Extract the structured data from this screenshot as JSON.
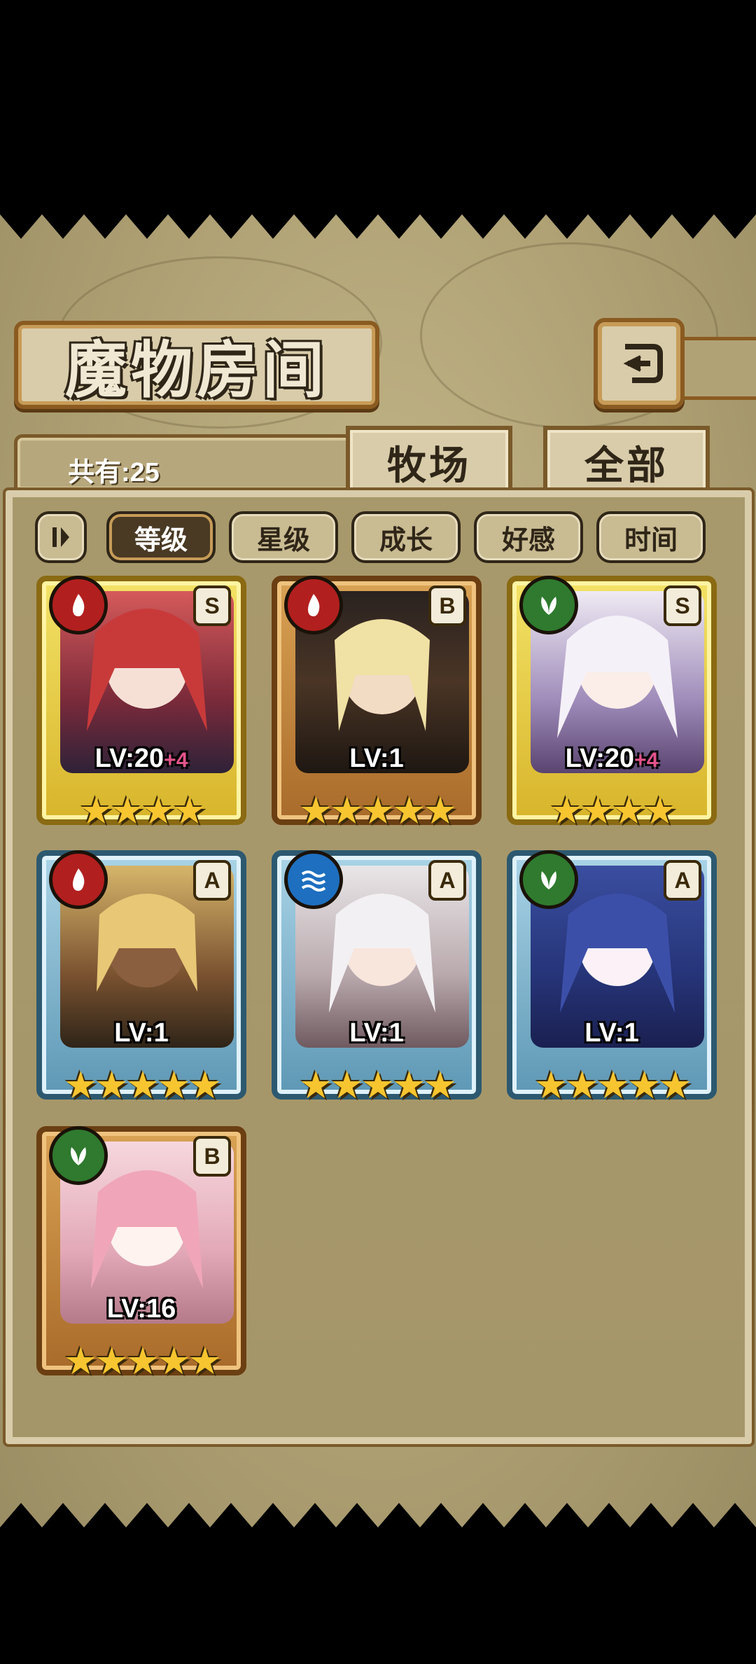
{
  "header": {
    "title": "魔物房间",
    "back_icon": "back-arrow-icon"
  },
  "summary": {
    "count_label": "共有:25"
  },
  "top_tabs": [
    {
      "label": "牧场"
    },
    {
      "label": "全部"
    }
  ],
  "sort": {
    "toggle_icon": "sort-toggle-icon",
    "buttons": [
      {
        "label": "等级",
        "active": true
      },
      {
        "label": "星级",
        "active": false
      },
      {
        "label": "成长",
        "active": false
      },
      {
        "label": "好感",
        "active": false
      },
      {
        "label": "时间",
        "active": false
      }
    ]
  },
  "monsters": [
    {
      "element": "fire-icon",
      "rank": "S",
      "frame": "gold",
      "level": "LV:20",
      "bonus": "+4",
      "stars": 4
    },
    {
      "element": "fire-icon",
      "rank": "B",
      "frame": "bronze",
      "level": "LV:1",
      "bonus": "",
      "stars": 5
    },
    {
      "element": "grass-icon",
      "rank": "S",
      "frame": "gold",
      "level": "LV:20",
      "bonus": "+4",
      "stars": 4
    },
    {
      "element": "fire-icon",
      "rank": "A",
      "frame": "blue",
      "level": "LV:1",
      "bonus": "",
      "stars": 5
    },
    {
      "element": "water-icon",
      "rank": "A",
      "frame": "blue",
      "level": "LV:1",
      "bonus": "",
      "stars": 5
    },
    {
      "element": "grass-icon",
      "rank": "A",
      "frame": "blue",
      "level": "LV:1",
      "bonus": "",
      "stars": 5
    },
    {
      "element": "grass-icon",
      "rank": "B",
      "frame": "bronze",
      "level": "LV:16",
      "bonus": "",
      "stars": 5
    }
  ],
  "colors": {
    "panel_bg": "#ad9f72",
    "frame_brown": "#7a5a2a",
    "star": "#f7c52f",
    "bonus_pink": "#e2548b"
  }
}
